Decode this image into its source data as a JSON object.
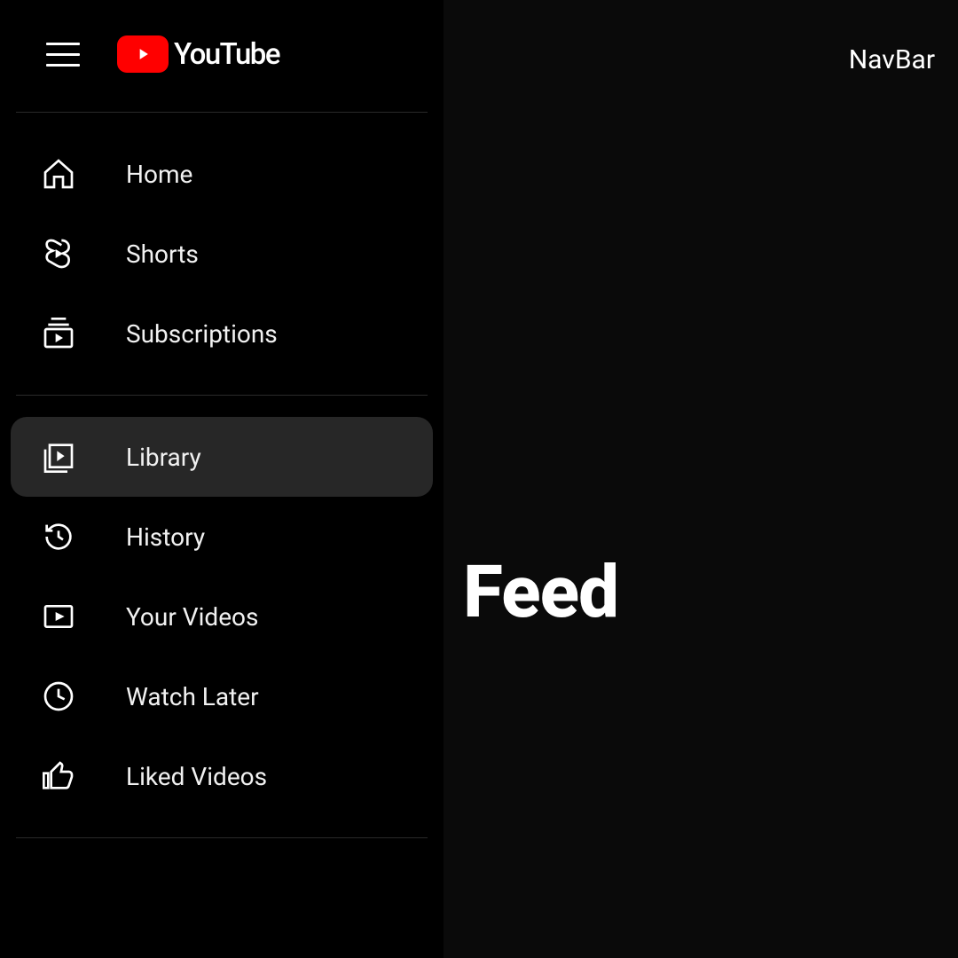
{
  "brand": "YouTube",
  "sidebar": {
    "groups": [
      {
        "items": [
          {
            "id": "home",
            "label": "Home",
            "icon": "home-icon",
            "active": false
          },
          {
            "id": "shorts",
            "label": "Shorts",
            "icon": "shorts-icon",
            "active": false
          },
          {
            "id": "subscriptions",
            "label": "Subscriptions",
            "icon": "subscriptions-icon",
            "active": false
          }
        ]
      },
      {
        "items": [
          {
            "id": "library",
            "label": "Library",
            "icon": "library-icon",
            "active": true
          },
          {
            "id": "history",
            "label": "History",
            "icon": "history-icon",
            "active": false
          },
          {
            "id": "your-videos",
            "label": "Your Videos",
            "icon": "play-box-icon",
            "active": false
          },
          {
            "id": "watch-later",
            "label": "Watch Later",
            "icon": "clock-icon",
            "active": false
          },
          {
            "id": "liked-videos",
            "label": "Liked Videos",
            "icon": "thumbs-up-icon",
            "active": false
          }
        ]
      }
    ]
  },
  "main": {
    "navbar_label": "NavBar",
    "feed_label": "Feed"
  }
}
